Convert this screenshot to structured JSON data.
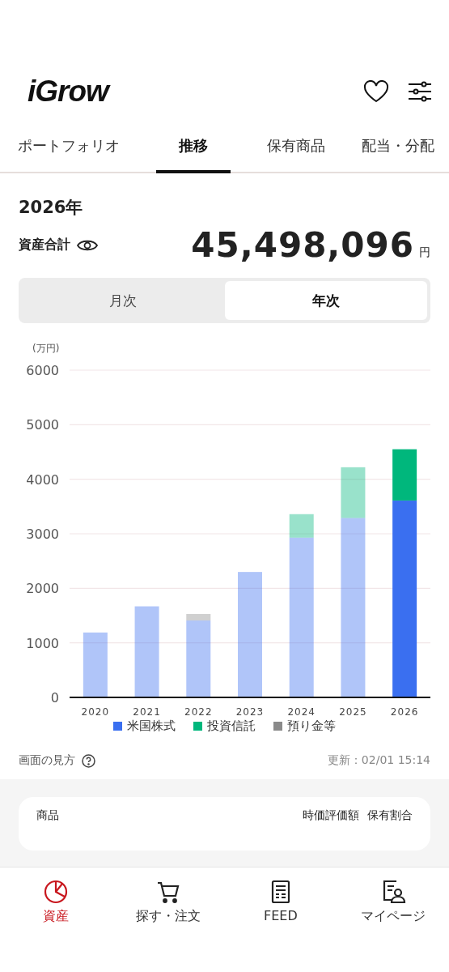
{
  "header": {
    "logo": "iGrow"
  },
  "tabs": [
    {
      "label": "ポートフォリオ",
      "selected": false
    },
    {
      "label": "推移",
      "selected": true
    },
    {
      "label": "保有商品",
      "selected": false
    },
    {
      "label": "配当・分配",
      "selected": false
    }
  ],
  "summary": {
    "year": "2026年",
    "total_label": "資産合計",
    "total_value": "45,498,096",
    "unit": "円"
  },
  "period_toggle": [
    {
      "label": "月次",
      "selected": false
    },
    {
      "label": "年次",
      "selected": true
    }
  ],
  "chart": {
    "unit_label": "(万円)",
    "chart_data": {
      "type": "bar",
      "stacked": true,
      "grid": true,
      "categories": [
        "2020",
        "2021",
        "2022",
        "2023",
        "2024",
        "2025",
        "2026"
      ],
      "ylim": [
        0,
        6000
      ],
      "yticks": [
        0,
        1000,
        2000,
        3000,
        4000,
        5000,
        6000
      ],
      "series": [
        {
          "name": "米国株式",
          "color": "#3a6ff0",
          "values": [
            1190,
            1670,
            1410,
            2300,
            2930,
            3290,
            3610
          ]
        },
        {
          "name": "投資信託",
          "color": "#00b77c",
          "values": [
            0,
            0,
            0,
            0,
            430,
            930,
            940
          ]
        },
        {
          "name": "預り金等",
          "color": "#8a8a8a",
          "values": [
            0,
            0,
            120,
            0,
            0,
            0,
            0
          ]
        }
      ]
    }
  },
  "footer": {
    "help": "画面の見方",
    "updated": "更新：02/01 15:14"
  },
  "holdings_card": {
    "columns": [
      "商品",
      "時価評価額",
      "保有割合"
    ]
  },
  "bottom_nav": [
    {
      "label": "資産",
      "selected": true
    },
    {
      "label": "探す・注文",
      "selected": false
    },
    {
      "label": "FEED",
      "selected": false
    },
    {
      "label": "マイページ",
      "selected": false
    }
  ]
}
